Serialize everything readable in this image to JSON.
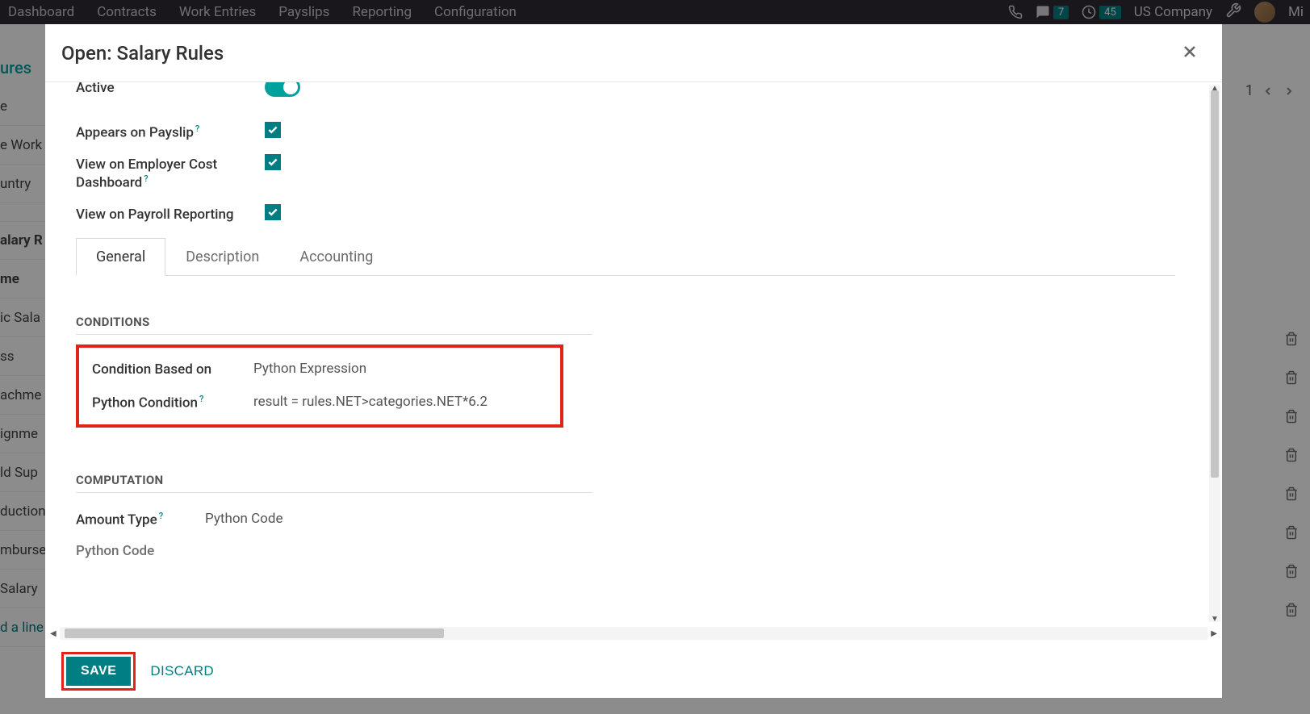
{
  "topbar": {
    "nav": [
      "Dashboard",
      "Contracts",
      "Work Entries",
      "Payslips",
      "Reporting",
      "Configuration"
    ],
    "msg_badge": "7",
    "clock_badge": "45",
    "company": "US Company",
    "user_short": "Mi"
  },
  "sidebar": {
    "heading": "ures",
    "items": [
      "e",
      "e Work",
      "untry",
      "alary R",
      "me",
      "ic Sala",
      "ss",
      "achme",
      "ignme",
      "ld Sup",
      "duction",
      "mburse",
      "Salary"
    ],
    "add_line": "d a line"
  },
  "pager": {
    "text": "1"
  },
  "modal": {
    "title": "Open: Salary Rules",
    "form": {
      "active_label": "Active",
      "appears_label": "Appears on Payslip",
      "employer_label": "View on Employer Cost Dashboard",
      "payroll_label": "View on Payroll Reporting"
    },
    "tabs": {
      "general": "General",
      "description": "Description",
      "accounting": "Accounting"
    },
    "sections": {
      "conditions_title": "CONDITIONS",
      "condition_based_label": "Condition Based on",
      "condition_based_value": "Python Expression",
      "python_cond_label": "Python Condition",
      "python_cond_value": "result = rules.NET>categories.NET*6.2",
      "computation_title": "COMPUTATION",
      "amount_type_label": "Amount Type",
      "amount_type_value": "Python Code",
      "python_code_label": "Python Code"
    },
    "footer": {
      "save": "SAVE",
      "discard": "DISCARD"
    }
  }
}
